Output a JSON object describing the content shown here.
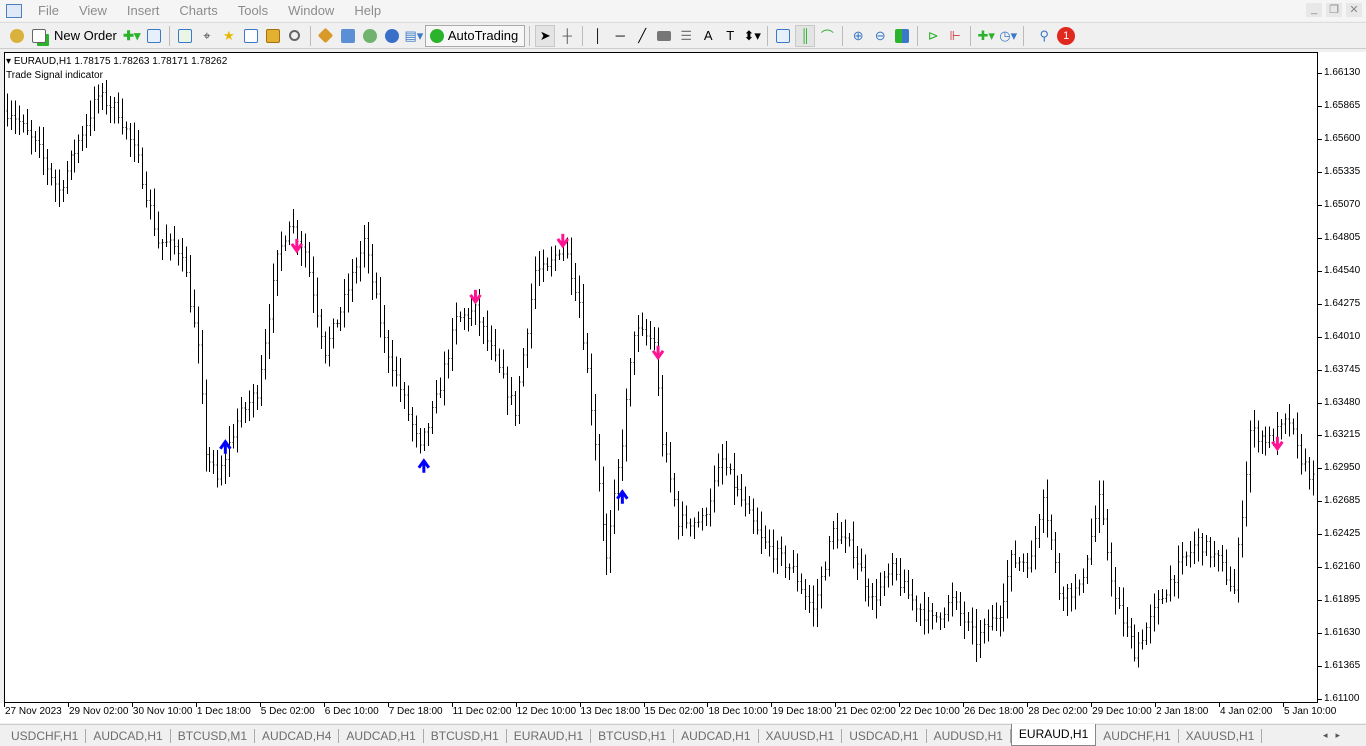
{
  "menu": [
    "File",
    "View",
    "Insert",
    "Charts",
    "Tools",
    "Window",
    "Help"
  ],
  "toolbar": {
    "new_order": "New Order",
    "auto_trading": "AutoTrading"
  },
  "chart": {
    "symbol_line": "EURAUD,H1  1.78175 1.78263 1.78171 1.78262",
    "indicator": "Trade Signal indicator"
  },
  "price_axis": [
    "1.66130",
    "1.65865",
    "1.65600",
    "1.65335",
    "1.65070",
    "1.64805",
    "1.64540",
    "1.64275",
    "1.64010",
    "1.63745",
    "1.63480",
    "1.63215",
    "1.62950",
    "1.62685",
    "1.62425",
    "1.62160",
    "1.61895",
    "1.61630",
    "1.61365",
    "1.61100"
  ],
  "time_axis": [
    "27 Nov 2023",
    "29 Nov 02:00",
    "30 Nov 10:00",
    "1 Dec 18:00",
    "5 Dec 02:00",
    "6 Dec 10:00",
    "7 Dec 18:00",
    "11 Dec 02:00",
    "12 Dec 10:00",
    "13 Dec 18:00",
    "15 Dec 02:00",
    "18 Dec 10:00",
    "19 Dec 18:00",
    "21 Dec 02:00",
    "22 Dec 10:00",
    "26 Dec 18:00",
    "28 Dec 02:00",
    "29 Dec 10:00",
    "2 Jan 18:00",
    "4 Jan 02:00",
    "5 Jan 10:00"
  ],
  "tabs": [
    "USDCHF,H1",
    "AUDCAD,H1",
    "BTCUSD,M1",
    "AUDCAD,H4",
    "AUDCAD,H1",
    "BTCUSD,H1",
    "EURAUD,H1",
    "BTCUSD,H1",
    "AUDCAD,H1",
    "XAUUSD,H1",
    "USDCAD,H1",
    "AUDUSD,H1",
    "EURAUD,H1",
    "AUDCHF,H1",
    "XAUUSD,H1"
  ],
  "active_tab": 12,
  "notification_count": "1",
  "colors": {
    "sell_arrow": "#ff1493",
    "buy_arrow": "#0000ff",
    "bars": "#000000"
  },
  "chart_data": {
    "type": "ohlc-bars",
    "bars": 330,
    "ylim": [
      1.611,
      1.6613
    ],
    "path": [
      [
        1,
        1.65833
      ],
      [
        8,
        1.65512
      ],
      [
        13,
        1.6519
      ],
      [
        18,
        1.65592
      ],
      [
        23,
        1.65953
      ],
      [
        28,
        1.65833
      ],
      [
        33,
        1.65431
      ],
      [
        38,
        1.64789
      ],
      [
        44,
        1.64709
      ],
      [
        48,
        1.63906
      ],
      [
        50,
        1.63103
      ],
      [
        53,
        1.62862
      ],
      [
        58,
        1.63344
      ],
      [
        63,
        1.63584
      ],
      [
        68,
        1.64628
      ],
      [
        71,
        1.6495
      ],
      [
        75,
        1.64709
      ],
      [
        80,
        1.63906
      ],
      [
        85,
        1.64307
      ],
      [
        90,
        1.64789
      ],
      [
        95,
        1.63986
      ],
      [
        100,
        1.63504
      ],
      [
        104,
        1.63103
      ],
      [
        108,
        1.63504
      ],
      [
        113,
        1.64147
      ],
      [
        118,
        1.64227
      ],
      [
        123,
        1.63825
      ],
      [
        128,
        1.63424
      ],
      [
        133,
        1.64548
      ],
      [
        136,
        1.64548
      ],
      [
        140,
        1.64789
      ],
      [
        144,
        1.64307
      ],
      [
        148,
        1.63183
      ],
      [
        151,
        1.62219
      ],
      [
        155,
        1.63183
      ],
      [
        158,
        1.64066
      ],
      [
        163,
        1.63986
      ],
      [
        165,
        1.63183
      ],
      [
        169,
        1.62541
      ],
      [
        175,
        1.62541
      ],
      [
        180,
        1.63022
      ],
      [
        185,
        1.62701
      ],
      [
        190,
        1.6238
      ],
      [
        198,
        1.62139
      ],
      [
        203,
        1.61818
      ],
      [
        208,
        1.6246
      ],
      [
        213,
        1.623
      ],
      [
        218,
        1.61898
      ],
      [
        223,
        1.62139
      ],
      [
        228,
        1.61898
      ],
      [
        233,
        1.61738
      ],
      [
        238,
        1.61898
      ],
      [
        244,
        1.61577
      ],
      [
        250,
        1.61818
      ],
      [
        253,
        1.62219
      ],
      [
        258,
        1.62219
      ],
      [
        261,
        1.62781
      ],
      [
        265,
        1.61978
      ],
      [
        270,
        1.61978
      ],
      [
        275,
        1.62701
      ],
      [
        279,
        1.61898
      ],
      [
        284,
        1.61497
      ],
      [
        288,
        1.61738
      ],
      [
        293,
        1.62059
      ],
      [
        300,
        1.6238
      ],
      [
        305,
        1.62219
      ],
      [
        309,
        1.61978
      ],
      [
        313,
        1.63263
      ],
      [
        318,
        1.63183
      ],
      [
        323,
        1.63344
      ],
      [
        325,
        1.63103
      ],
      [
        329,
        1.62862
      ]
    ],
    "signals": [
      {
        "bar": 55,
        "price": 1.63135,
        "dir": "buy"
      },
      {
        "bar": 73,
        "price": 1.64749,
        "dir": "sell"
      },
      {
        "bar": 105,
        "price": 1.62982,
        "dir": "buy"
      },
      {
        "bar": 118,
        "price": 1.64339,
        "dir": "sell"
      },
      {
        "bar": 140,
        "price": 1.64789,
        "dir": "sell"
      },
      {
        "bar": 155,
        "price": 1.62733,
        "dir": "buy"
      },
      {
        "bar": 164,
        "price": 1.6389,
        "dir": "sell"
      },
      {
        "bar": 320,
        "price": 1.63159,
        "dir": "sell"
      }
    ]
  }
}
